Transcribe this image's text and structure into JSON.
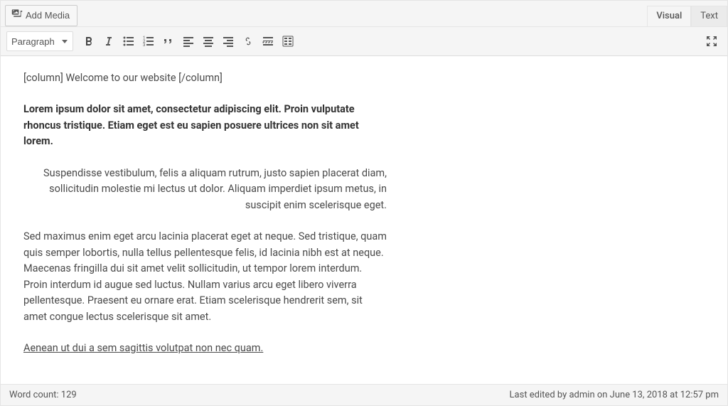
{
  "topbar": {
    "add_media_label": "Add Media"
  },
  "tabs": {
    "visual": "Visual",
    "text": "Text"
  },
  "toolbar": {
    "format_select": "Paragraph"
  },
  "content": {
    "p1": "[column] Welcome to our website [/column]",
    "p2": "Lorem ipsum dolor sit amet, consectetur adipiscing elit. Proin vulputate rhoncus tristique. Etiam eget est eu sapien posuere ultrices non sit amet lorem.",
    "p3": "Suspendisse vestibulum, felis a aliquam rutrum, justo sapien placerat diam, sollicitudin molestie mi lectus ut dolor. Aliquam imperdiet ipsum metus, in suscipit enim scelerisque eget.",
    "p4": "Sed maximus enim eget arcu lacinia placerat eget at neque. Sed tristique, quam quis semper lobortis, nulla tellus pellentesque felis, id lacinia nibh est at neque. Maecenas fringilla dui sit amet velit sollicitudin, ut tempor lorem interdum. Proin interdum id augue sed luctus. Nullam varius arcu eget libero viverra pellentesque. Praesent eu ornare erat. Etiam scelerisque hendrerit sem, sit amet congue lectus scelerisque sit amet.",
    "p5": "Aenean ut dui a sem sagittis volutpat non nec quam."
  },
  "status": {
    "word_count": "Word count: 129",
    "last_edited": "Last edited by admin on June 13, 2018 at 12:57 pm"
  }
}
